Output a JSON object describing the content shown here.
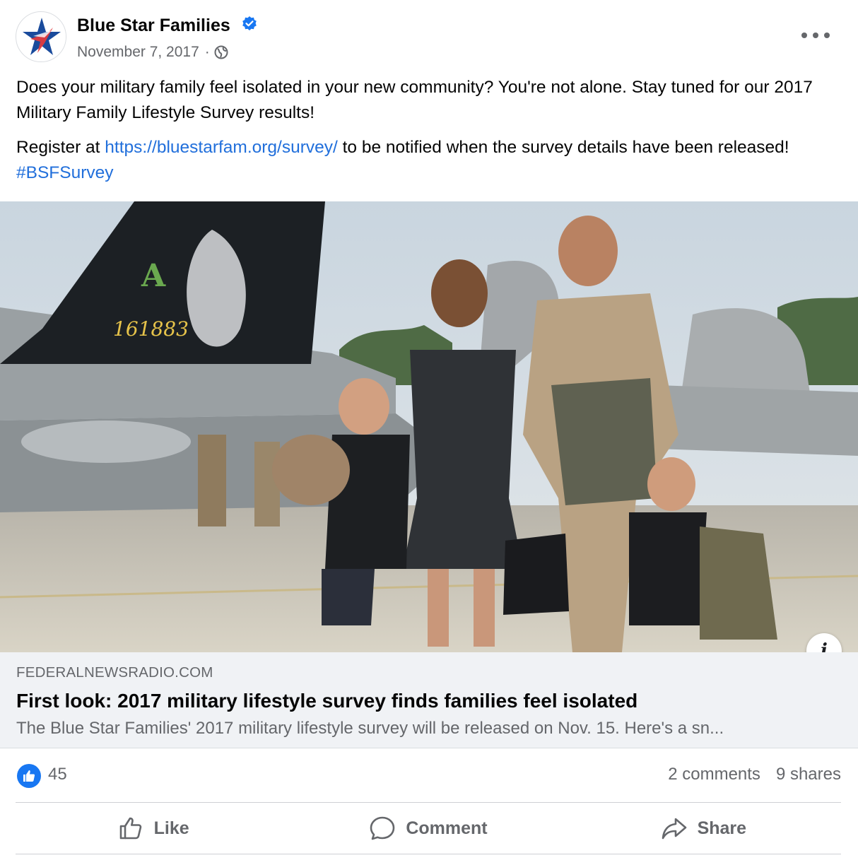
{
  "post": {
    "page_name": "Blue Star Families",
    "date": "November 7, 2017",
    "separator": "·",
    "audience_icon": "globe-icon",
    "text_1": "Does your military family feel isolated in your new community? You're not alone. Stay tuned for our 2017 Military Family Lifestyle Survey results!",
    "text_2_prefix": "Register at ",
    "text_2_link": "https://bluestarfam.org/survey/",
    "text_2_middle": " to be notified when the survey details have been released! ",
    "text_2_hashtag": "#BSFSurvey"
  },
  "image": {
    "tail_number": "161883"
  },
  "link_card": {
    "domain": "FEDERALNEWSRADIO.COM",
    "headline": "First look: 2017 military lifestyle survey finds families feel isolated",
    "description": "The Blue Star Families' 2017 military lifestyle survey will be released on Nov. 15. Here's a sn...",
    "info_label": "i"
  },
  "stats": {
    "likes": "45",
    "comments": "2 comments",
    "shares": "9 shares"
  },
  "actions": {
    "like": "Like",
    "comment": "Comment",
    "share": "Share"
  },
  "colors": {
    "accent": "#1877f2",
    "link": "#216fdb",
    "muted": "#65676b",
    "card_bg": "#f0f2f5"
  }
}
